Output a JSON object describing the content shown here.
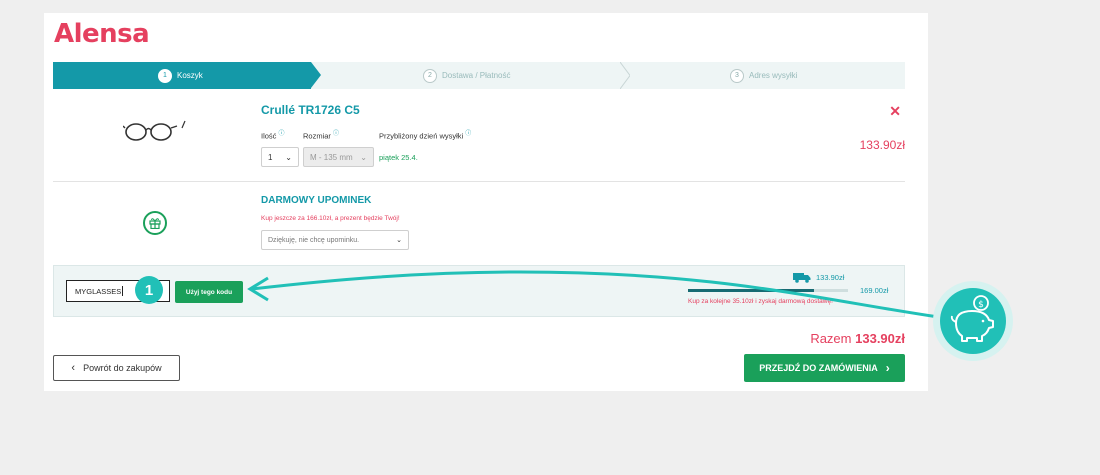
{
  "brand": {
    "logo": "Alensa",
    "accent": "#1499a8",
    "brand_color": "#e5405f",
    "green": "#1aa05a"
  },
  "steps": [
    {
      "num": "1",
      "label": "Koszyk",
      "active": true
    },
    {
      "num": "2",
      "label": "Dostawa / Płatność",
      "active": false
    },
    {
      "num": "3",
      "label": "Adres wysyłki",
      "active": false
    }
  ],
  "product": {
    "name": "Crullé TR1726 C5",
    "qty_label": "Ilość",
    "size_label": "Rozmiar",
    "ship_label": "Przybliżony dzień wysyłki",
    "qty_value": "1",
    "size_value": "M - 135 mm",
    "ship_value": "piątek 25.4.",
    "price": "133.90zł",
    "remove_icon": "close-icon",
    "image_icon": "glasses-icon"
  },
  "gift": {
    "title": "DARMOWY UPOMINEK",
    "note": "Kup jeszcze za 166.10zł, a prezent będzie Twój!",
    "select_value": "Dziękuję, nie chcę upominku.",
    "icon": "gift-icon"
  },
  "coupon": {
    "code_value": "MYGLASSES",
    "use_button": "Użyj tego kodu",
    "step_badge": "1"
  },
  "shipping": {
    "current_amount": "133.90zł",
    "target_amount": "169.00zł",
    "progress_fraction": 0.79,
    "note": "Kup za kolejne 35.10zł i zyskaj darmową dostawę!",
    "icon": "truck-icon"
  },
  "total": {
    "label": "Razem",
    "value": "133.90zł"
  },
  "actions": {
    "back": "Powrót do zakupów",
    "next": "PRZEJDŹ DO ZAMÓWIENIA"
  },
  "overlay": {
    "icon": "piggy-bank-icon"
  }
}
